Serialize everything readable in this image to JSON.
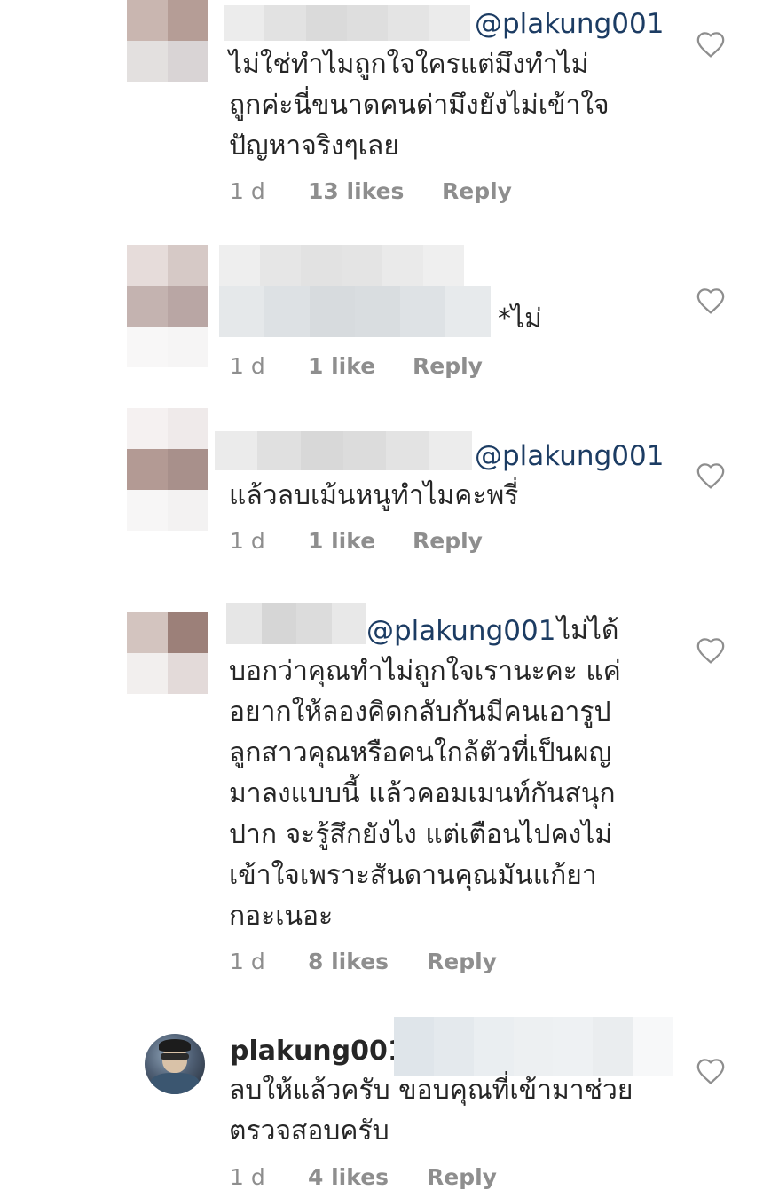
{
  "comments": [
    {
      "mention": "@plakung001",
      "text_lines": [
        "ไม่ใช่ทำไมถูกใจใครแต่มึงทำไม่",
        "ถูกค่ะนี่ขนาดคนด่ามึงยังไม่เข้าใจ",
        "ปัญหาจริงๆเลย"
      ],
      "time": "1 d",
      "likes": "13 likes",
      "reply": "Reply"
    },
    {
      "text_suffix": "*ไม่",
      "time": "1 d",
      "likes": "1 like",
      "reply": "Reply"
    },
    {
      "mention": "@plakung001",
      "text_lines": [
        "แล้วลบเม้นหนูทำไมคะพรี่"
      ],
      "time": "1 d",
      "likes": "1 like",
      "reply": "Reply"
    },
    {
      "mention": "@plakung001",
      "first_line_tail": "ไม่ได้",
      "text_lines": [
        "บอกว่าคุณทำไม่ถูกใจเรานะคะ แค่",
        "อยากให้ลองคิดกลับกันมีคนเอารูป",
        "ลูกสาวคุณหรือคนใกล้ตัวที่เป็นผญ",
        "มาลงแบบนี้ แล้วคอมเมนท์กันสนุก",
        "ปาก จะรู้สึกยังไง แต่เตือนไปคงไม่",
        "เข้าใจเพราะสันดานคุณมันแก้ยา",
        "กอะเนอะ"
      ],
      "time": "1 d",
      "likes": "8 likes",
      "reply": "Reply"
    },
    {
      "username": "plakung001",
      "text_lines": [
        "ลบให้แล้วครับ ขอบคุณที่เข้ามาช่วย",
        "ตรวจสอบครับ"
      ],
      "time": "1 d",
      "likes": "4 likes",
      "reply": "Reply"
    }
  ],
  "icons": {
    "like": "heart-outline-icon"
  },
  "colors": {
    "text": "#262626",
    "mention": "#1c3c63",
    "meta": "#8e8e8e",
    "heart_stroke": "#8e8e8e"
  }
}
